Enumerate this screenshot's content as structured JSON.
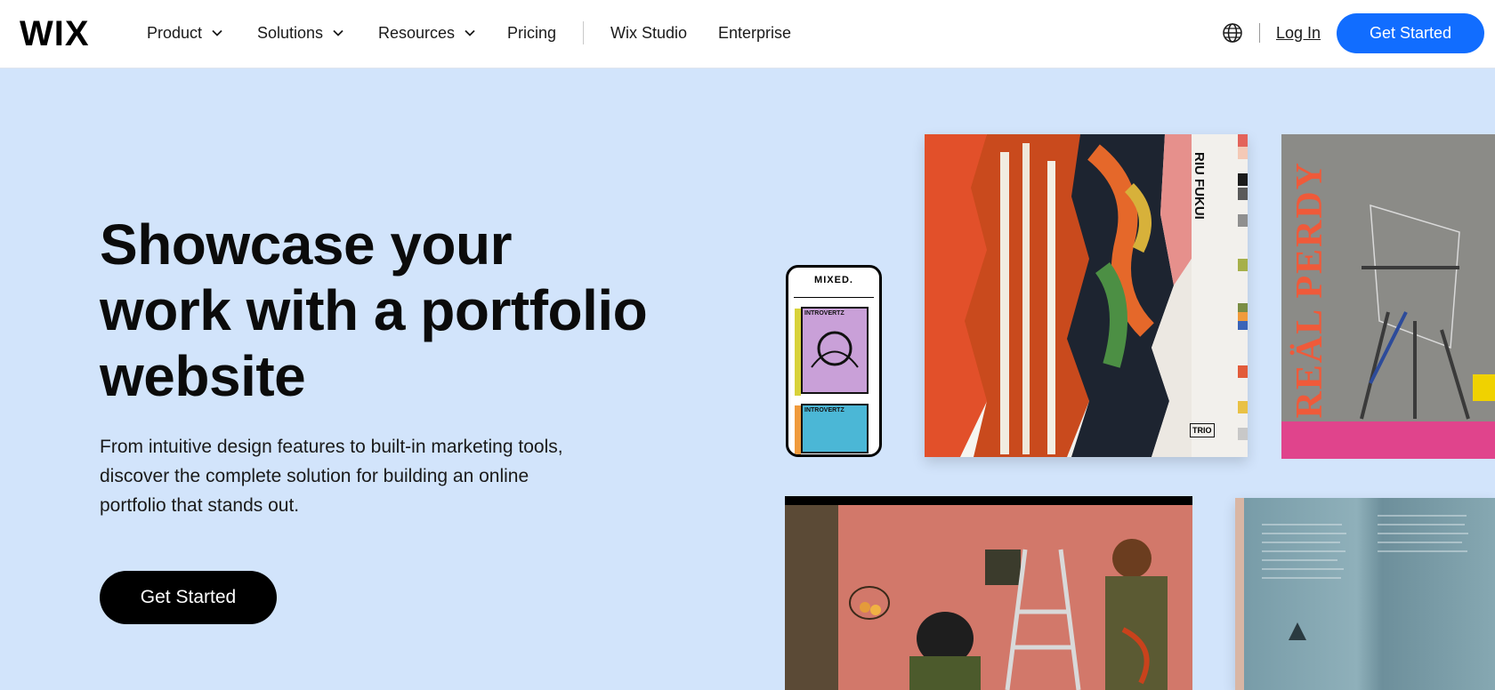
{
  "brand": {
    "logo": "WIX",
    "accent": "#116dff",
    "hero_bg": "#d2e4fb"
  },
  "nav": {
    "items": [
      {
        "label": "Product",
        "has_dropdown": true
      },
      {
        "label": "Solutions",
        "has_dropdown": true
      },
      {
        "label": "Resources",
        "has_dropdown": true
      },
      {
        "label": "Pricing",
        "has_dropdown": false
      },
      {
        "label": "Wix Studio",
        "has_dropdown": false
      },
      {
        "label": "Enterprise",
        "has_dropdown": false
      }
    ],
    "language_icon": "globe-icon",
    "login": "Log In",
    "cta": "Get Started"
  },
  "hero": {
    "title": "Showcase your work with a portfolio website",
    "subtitle": "From intuitive design features to built-in marketing tools, discover the complete solution for building an online portfolio that stands out.",
    "cta": "Get Started"
  },
  "artwork": {
    "phone_header": "MIXED.",
    "phone_card1": "INTROVERTZ",
    "phone_card2": "INTROVERTZ",
    "poster1_text": "RIU FUKUI",
    "poster1_badge": "TRIO",
    "poster2_text": "REÄL PERDY"
  }
}
